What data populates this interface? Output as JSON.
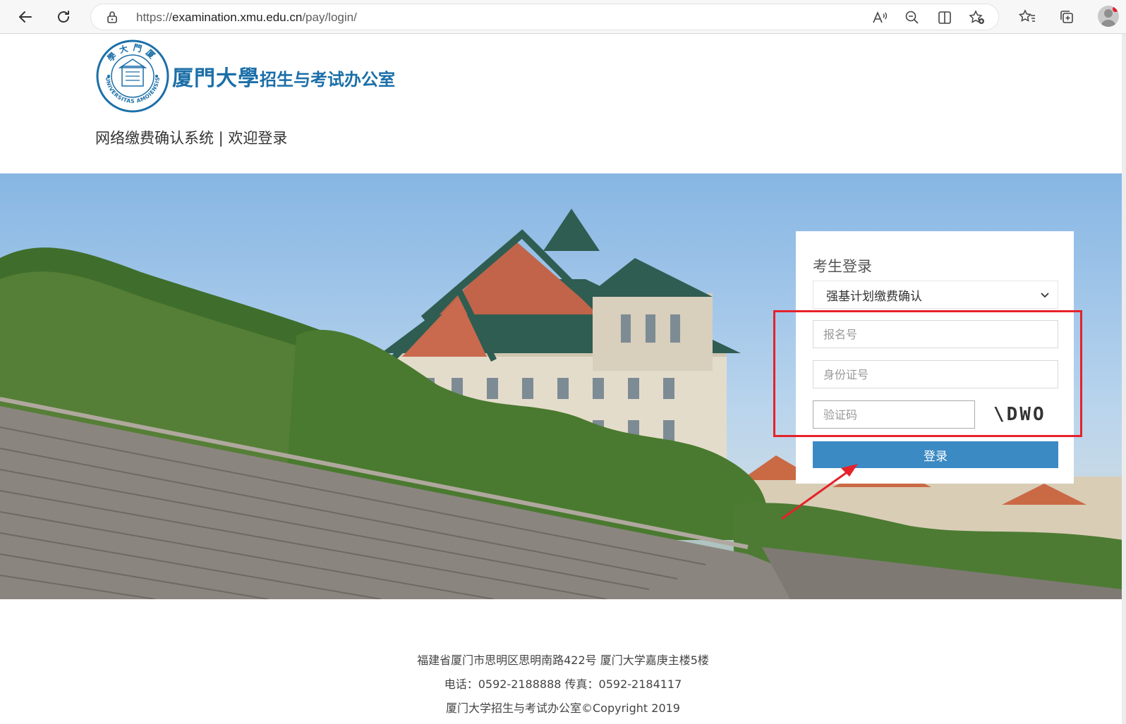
{
  "browser": {
    "url_scheme": "https://",
    "url_host": "examination.xmu.edu.cn",
    "url_path": "/pay/login/"
  },
  "header": {
    "logo_main": "厦門大學",
    "logo_sub": "招生与考试办公室",
    "seal_top_text": "學大門厦",
    "seal_bottom_text": "UNIVERSITAS AMOIENSIS",
    "page_title": "网络缴费确认系统 | 欢迎登录"
  },
  "login": {
    "title": "考生登录",
    "type_selected": "强基计划缴费确认",
    "registration_placeholder": "报名号",
    "idcard_placeholder": "身份证号",
    "captcha_placeholder": "验证码",
    "captcha_text": "\\DWO",
    "submit_label": "登录"
  },
  "annotation": {
    "color": "#e5222a"
  },
  "footer": {
    "address": "福建省厦门市思明区思明南路422号 厦门大学嘉庚主楼5楼",
    "contact": "电话：0592-2188888 传真：0592-2184117",
    "copyright": "厦门大学招生与考试办公室©Copyright 2019"
  },
  "colors": {
    "brand_blue": "#1b6fa8",
    "button_blue": "#3b8ac4"
  }
}
